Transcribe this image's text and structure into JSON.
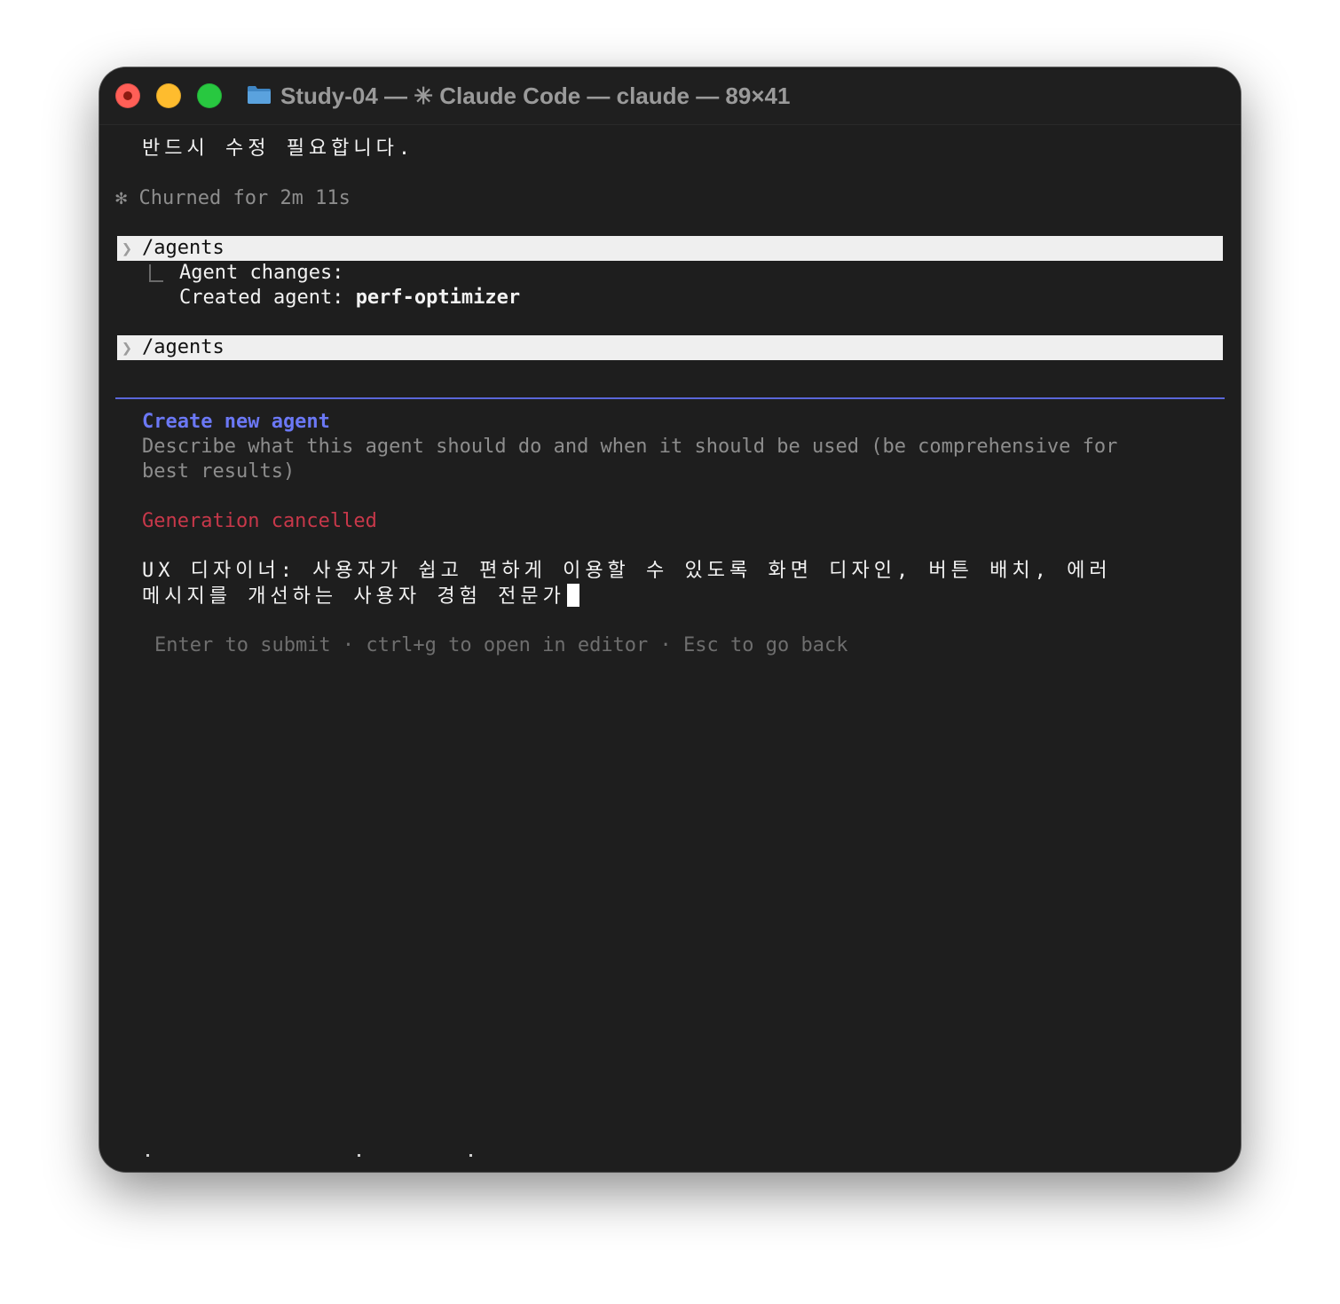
{
  "window": {
    "title": "Study-04 — ✳ Claude Code — claude — 89×41"
  },
  "terminal": {
    "top_message": "반드시 수정 필요합니다.",
    "status_glyph": "✻",
    "status_text": "Churned for 2m 11s",
    "prompt_glyph": "❯",
    "command_1": "/agents",
    "agent_changes_label": "Agent changes:",
    "created_agent_prefix": "Created agent: ",
    "created_agent_name": "perf-optimizer",
    "command_2": "/agents"
  },
  "dialog": {
    "heading": "Create new agent",
    "description_line1": "Describe what this agent should do and when it should be used (be comprehensive for",
    "description_line2": "best results)",
    "error_text": "Generation cancelled",
    "input_line1": "UX 디자이너: 사용자가 쉽고 편하게 이용할 수 있도록 화면 디자인, 버튼 배치, 에러",
    "input_line2": "메시지를 개선하는 사용자 경험 전문가",
    "hint": "Enter to submit · ctrl+g to open in editor · Esc to go back"
  },
  "colors": {
    "terminal_bg": "#1e1e1e",
    "accent": "#6b78f5",
    "error": "#c8384a",
    "command_bar_bg": "#efefef"
  }
}
